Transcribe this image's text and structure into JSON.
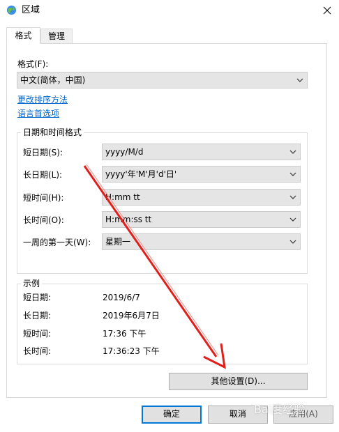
{
  "window": {
    "title": "区域"
  },
  "tabs": [
    {
      "label": "格式",
      "active": true
    },
    {
      "label": "管理",
      "active": false
    }
  ],
  "format": {
    "label": "格式(F):",
    "value": "中文(简体，中国)"
  },
  "links": {
    "sort": "更改排序方法",
    "language": "语言首选项"
  },
  "datetime": {
    "group_title": "日期和时间格式",
    "rows": [
      {
        "label": "短日期(S):",
        "value": "yyyy/M/d"
      },
      {
        "label": "长日期(L):",
        "value": "yyyy'年'M'月'd'日'"
      },
      {
        "label": "短时间(H):",
        "value": "H:mm tt"
      },
      {
        "label": "长时间(O):",
        "value": "H:mm:ss tt"
      },
      {
        "label": "一周的第一天(W):",
        "value": "星期一"
      }
    ]
  },
  "examples": {
    "group_title": "示例",
    "rows": [
      {
        "label": "短日期:",
        "value": "2019/6/7"
      },
      {
        "label": "长日期:",
        "value": "2019年6月7日"
      },
      {
        "label": "短时间:",
        "value": "17:36 下午"
      },
      {
        "label": "长时间:",
        "value": "17:36:23 下午"
      }
    ]
  },
  "buttons": {
    "other_settings": "其他设置(D)...",
    "ok": "确定",
    "cancel": "取消",
    "apply": "应用(A)"
  },
  "watermark": {
    "text": "Bai度经验"
  },
  "colors": {
    "link": "#0066cc",
    "focus_border": "#0078d7",
    "arrow": "#e0201b",
    "combo_bg": "#e5e5e5"
  },
  "icons": {
    "title": "globe-icon",
    "close": "close-icon",
    "dropdown": "chevron-down-icon"
  }
}
